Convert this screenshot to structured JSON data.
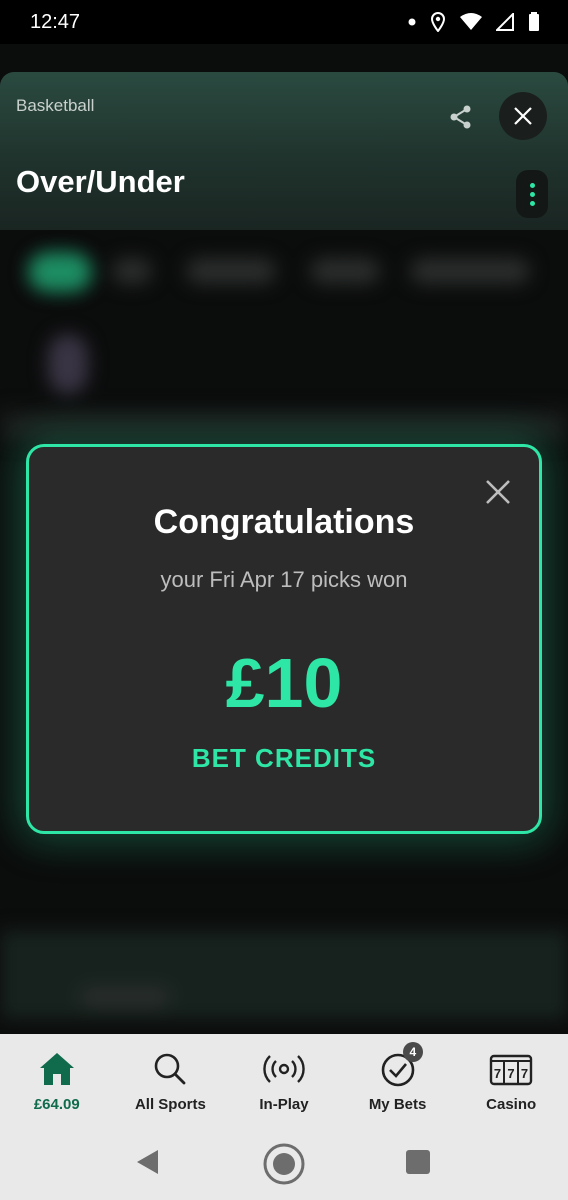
{
  "status_bar": {
    "time": "12:47"
  },
  "sheet": {
    "sport": "Basketball",
    "title": "Over/Under"
  },
  "dialog": {
    "title": "Congratulations",
    "subtitle": "your Fri Apr 17 picks won",
    "amount": "£10",
    "credits_label": "BET CREDITS"
  },
  "bottom_nav": {
    "items": [
      {
        "label": "£64.09",
        "icon": "home-icon",
        "active": true
      },
      {
        "label": "All Sports",
        "icon": "search-icon"
      },
      {
        "label": "In-Play",
        "icon": "broadcast-icon"
      },
      {
        "label": "My Bets",
        "icon": "check-circle-icon",
        "badge": "4"
      },
      {
        "label": "Casino",
        "icon": "slot-machine-icon"
      }
    ]
  },
  "colors": {
    "accent": "#2ee6a6",
    "active_nav": "#0f6b4b",
    "dialog_bg": "#2a2a2a"
  }
}
